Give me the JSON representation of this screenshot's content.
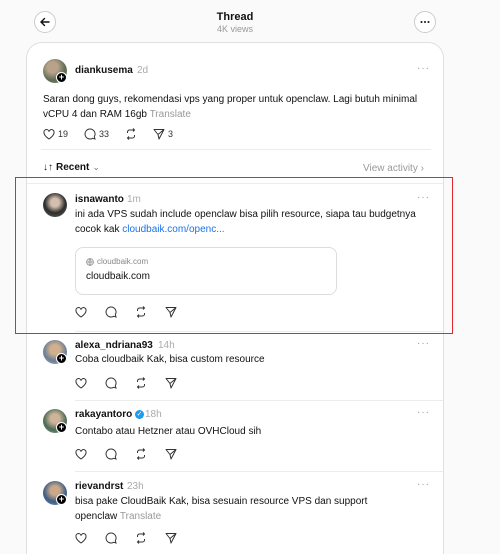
{
  "header": {
    "title": "Thread",
    "views": "4K views"
  },
  "main_post": {
    "username": "diankusema",
    "time": "2d",
    "text": "Saran dong guys, rekomendasi vps yang proper untuk openclaw. Lagi butuh minimal vCPU 4 dan RAM 16gb",
    "translate": "Translate",
    "likes": "19",
    "replies": "33",
    "shares": "3"
  },
  "sort": {
    "label": "Recent",
    "view_activity": "View activity"
  },
  "replies": [
    {
      "username": "isnawanto",
      "time": "1m",
      "text": "ini ada VPS sudah include openclaw bisa pilih resource, siapa tau budgetnya cocok kak",
      "link": "cloudbaik.com/openc...",
      "preview_domain": "cloudbaik.com",
      "preview_title": "cloudbaik.com"
    },
    {
      "username": "alexa_ndriana93",
      "time": "14h",
      "text": "Coba cloudbaik Kak, bisa custom resource"
    },
    {
      "username": "rakayantoro",
      "time": "18h",
      "text": "Contabo atau Hetzner atau OVHCloud sih",
      "verified_mark": "✓"
    },
    {
      "username": "rievandrst",
      "time": "23h",
      "text": "bisa pake CloudBaik Kak, bisa sesuain resource VPS dan support openclaw",
      "translate": "Translate"
    }
  ],
  "icons": {
    "back": "arrow-left-icon",
    "more": "more-horizontal-icon",
    "dots": "···",
    "plus": "+",
    "chevron": "⌄",
    "sort_arrows": "↓↑",
    "view_chevron": "›"
  },
  "colors": {
    "link": "#1a73e8",
    "highlight": "#e0282e",
    "verified": "#1d9bf0"
  }
}
